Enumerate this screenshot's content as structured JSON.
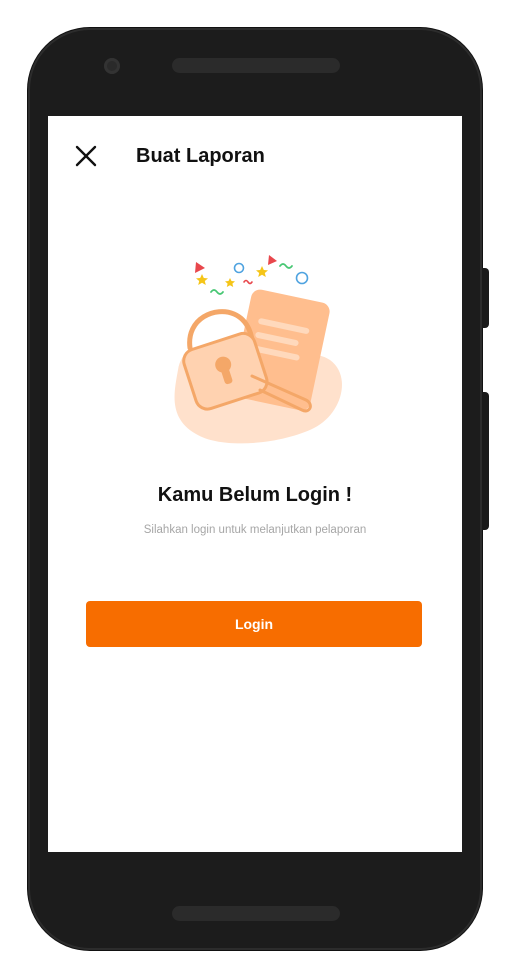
{
  "header": {
    "close_icon": "close-icon",
    "title": "Buat Laporan"
  },
  "illustration": {
    "icon": "lock-document-illustration-icon",
    "colors": {
      "blob": "#FFE1CC",
      "accent": "#FFB27A",
      "stroke": "#F4A768",
      "star": "#F5C518",
      "triangle": "#E8474C",
      "circle": "#4FA3E0",
      "squiggle": "#48C774"
    }
  },
  "main": {
    "headline": "Kamu Belum Login !",
    "subtext": "Silahkan login untuk melanjutkan pelaporan"
  },
  "actions": {
    "login_label": "Login",
    "login_color": "#F76D00"
  }
}
